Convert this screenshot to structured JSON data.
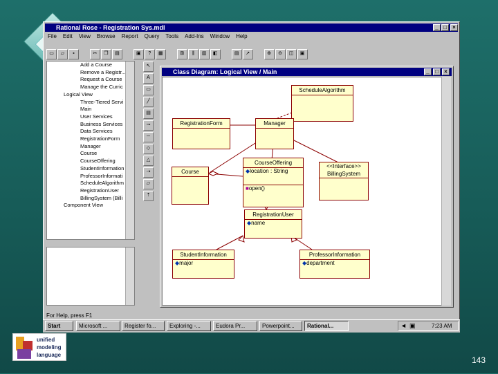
{
  "window": {
    "title": "Rational Rose - Registration Sys.mdl"
  },
  "menu": [
    "File",
    "Edit",
    "View",
    "Browse",
    "Report",
    "Query",
    "Tools",
    "Add-Ins",
    "Window",
    "Help"
  ],
  "tree": {
    "items": [
      {
        "label": "Add a Course"
      },
      {
        "label": "Remove a Registr..."
      },
      {
        "label": "Request a Course"
      },
      {
        "label": "Manage the Curric"
      },
      {
        "label": "Logical View"
      },
      {
        "label": "Three-Tiered Servi"
      },
      {
        "label": "Main"
      },
      {
        "label": "User Services"
      },
      {
        "label": "Business Services"
      },
      {
        "label": "Data Services"
      },
      {
        "label": "RegistrationForm"
      },
      {
        "label": "Manager"
      },
      {
        "label": "Course"
      },
      {
        "label": "CourseOffering"
      },
      {
        "label": "StudentInformation"
      },
      {
        "label": "ProfessorInformati"
      },
      {
        "label": "ScheduleAlgorithm"
      },
      {
        "label": "RegistrationUser"
      },
      {
        "label": "BillingSystem (Billi"
      },
      {
        "label": "Component View"
      }
    ]
  },
  "diagram": {
    "title": "Class Diagram: Logical View / Main",
    "classes": {
      "schedule": "ScheduleAlgorithm",
      "regform": "RegistrationForm",
      "manager": "Manager",
      "course": "Course",
      "offering": "CourseOffering",
      "offering_attr": "location : String",
      "offering_op": "open()",
      "billing_stereo": "<<Interface>>",
      "billing": "BillingSystem",
      "reguser": "RegistrationUser",
      "reguser_attr": "name",
      "student": "StudentInformation",
      "student_attr": "major",
      "prof": "ProfessorInformation",
      "prof_attr": "department"
    }
  },
  "status": {
    "text": "For Help, press F1"
  },
  "taskbar": {
    "items": [
      "Start",
      "Microsoft ...",
      "Register fo...",
      "Exploring -...",
      "Eudora Pr...",
      "Powerpoint...",
      "Rational..."
    ],
    "clock": "7:23 AM"
  },
  "logo": {
    "line1": "unified",
    "line2": "modeling",
    "line3": "language"
  },
  "slide": {
    "number": "143"
  }
}
